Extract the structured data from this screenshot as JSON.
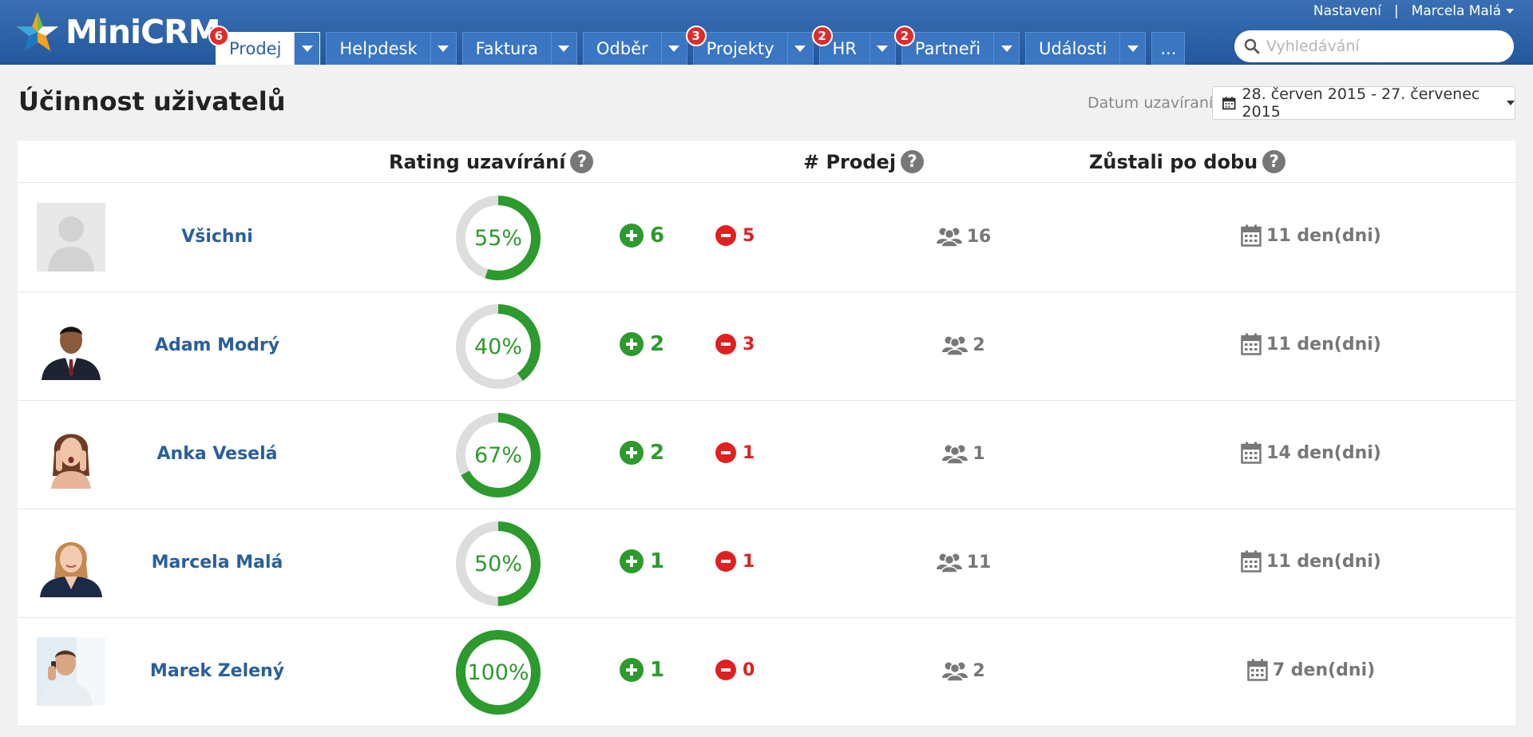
{
  "app": {
    "name": "MiniCRM"
  },
  "header": {
    "settings_label": "Nastavení",
    "separator": "|",
    "user_label": "Marcela Malá",
    "search_placeholder": "Vyhledávání"
  },
  "tabs": [
    {
      "label": "Prodej",
      "badge": "6",
      "active": true
    },
    {
      "label": "Helpdesk",
      "badge": ""
    },
    {
      "label": "Faktura",
      "badge": ""
    },
    {
      "label": "Odběr",
      "badge": ""
    },
    {
      "label": "Projekty",
      "badge": "3"
    },
    {
      "label": "HR",
      "badge": "2"
    },
    {
      "label": "Partneři",
      "badge": "2"
    },
    {
      "label": "Události",
      "badge": ""
    },
    {
      "label": "..."
    }
  ],
  "page": {
    "title": "Účinnost uživatelů",
    "date_label": "Datum uzavíraní:",
    "date_range": "28. červen 2015 - 27. červenec 2015"
  },
  "columns": {
    "rating": "Rating uzavírání",
    "deals": "# Prodej",
    "duration": "Zůstali po dobu",
    "help": "?"
  },
  "rows": [
    {
      "name": "Všichni",
      "rating": "55%",
      "rating_value": 55,
      "won": "6",
      "lost": "5",
      "deals": "16",
      "duration": "11 den(dni)",
      "avatar": "silhouette"
    },
    {
      "name": "Adam Modrý",
      "rating": "40%",
      "rating_value": 40,
      "won": "2",
      "lost": "3",
      "deals": "2",
      "duration": "11 den(dni)",
      "avatar": "man-suit"
    },
    {
      "name": "Anka Veselá",
      "rating": "67%",
      "rating_value": 67,
      "won": "2",
      "lost": "1",
      "deals": "1",
      "duration": "14 den(dni)",
      "avatar": "woman-surprised"
    },
    {
      "name": "Marcela Malá",
      "rating": "50%",
      "rating_value": 50,
      "won": "1",
      "lost": "1",
      "deals": "11",
      "duration": "11 den(dni)",
      "avatar": "woman-blazer"
    },
    {
      "name": "Marek Zelený",
      "rating": "100%",
      "rating_value": 100,
      "won": "1",
      "lost": "0",
      "deals": "2",
      "duration": "7 den(dni)",
      "avatar": "man-phone"
    }
  ],
  "colors": {
    "accent": "#2a5fa6",
    "green": "#2c9a2c",
    "red": "#e02020",
    "track": "#dddddd"
  }
}
